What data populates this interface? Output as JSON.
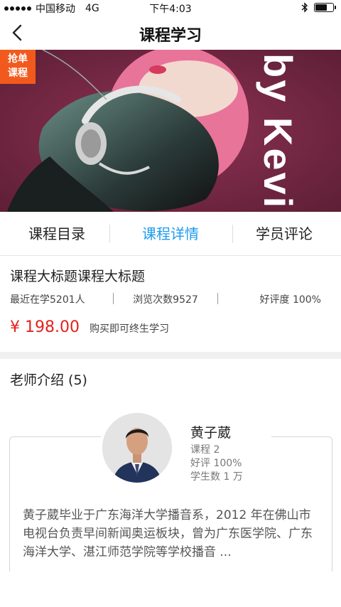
{
  "status_bar": {
    "carrier": "中国移动",
    "network": "4G",
    "time": "下午4:03"
  },
  "nav": {
    "title": "课程学习",
    "back_icon": "chevron-left-icon"
  },
  "banner": {
    "promo_tag_line1": "抢单",
    "promo_tag_line2": "课程",
    "overlay_text": "by Kevin"
  },
  "tabs": [
    {
      "label": "课程目录",
      "active": false
    },
    {
      "label": "课程详情",
      "active": true
    },
    {
      "label": "学员评论",
      "active": false
    }
  ],
  "course": {
    "title": "课程大标题课程大标题",
    "learners": "最近在学5201人",
    "views": "浏览次数9527",
    "rating": "好评度 100%",
    "price": "¥ 198.00",
    "price_note": "购买即可终生学习"
  },
  "teacher_section": {
    "header": "老师介绍 (5)",
    "teacher": {
      "name": "黄子葳",
      "courses": "课程 2",
      "rating": "好评 100%",
      "students": "学生数 1 万",
      "bio": "黄子葳毕业于广东海洋大学播音系，2012 年在佛山市电视台负责早间新闻奥运板块，曾为广东医学院、广东海洋大学、湛江师范学院等学校播音 ..."
    }
  },
  "colors": {
    "accent": "#1e9bf0",
    "price": "#e4211c",
    "promo": "#f25a1d"
  }
}
